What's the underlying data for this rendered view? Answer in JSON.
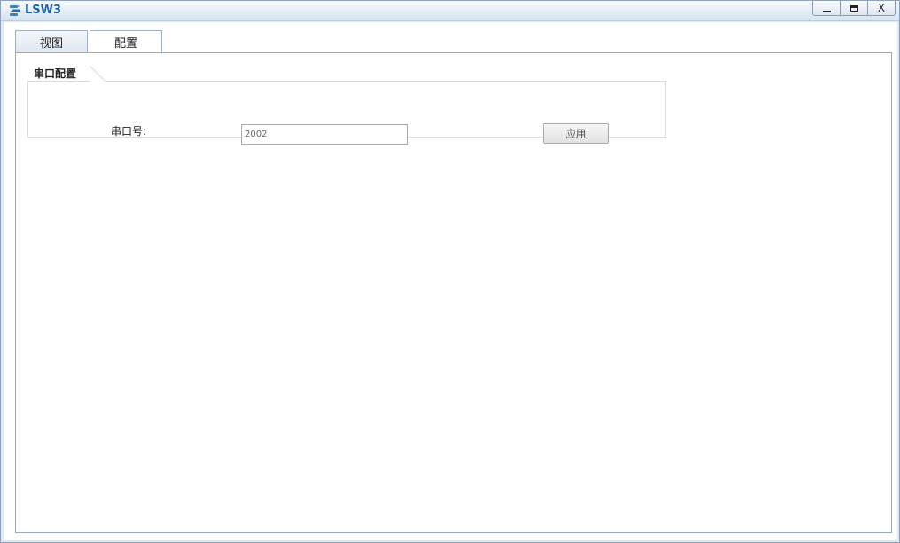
{
  "window": {
    "title": "LSW3",
    "icon": "switch-icon",
    "controls": {
      "minimize": "minimize-icon",
      "maximize": "maximize-icon",
      "close_label": "X"
    }
  },
  "tabs": [
    {
      "label": "视图"
    },
    {
      "label": "配置",
      "selected": true
    }
  ],
  "serial_config": {
    "title": "串口配置",
    "port_label": "串口号:",
    "port_value": "2002",
    "apply_label": "应用"
  }
}
